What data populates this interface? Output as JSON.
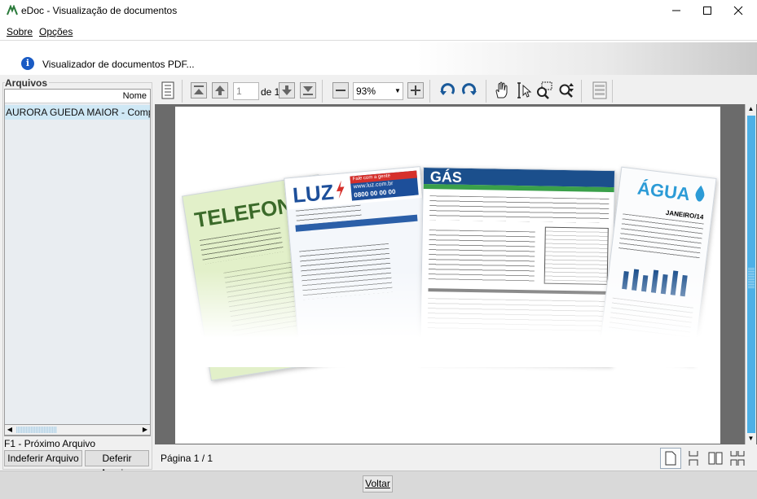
{
  "window": {
    "title": "eDoc - Visualização de documentos",
    "controls": {
      "minimize": "—",
      "maximize": "☐",
      "close": "✕"
    }
  },
  "menu": {
    "items": [
      {
        "label": "Sobre",
        "key": "S"
      },
      {
        "label": "Opções",
        "key": "O"
      }
    ]
  },
  "info": {
    "icon": "info-icon",
    "text": "Visualizador de documentos PDF..."
  },
  "files": {
    "group_label": "Arquivos",
    "column_header": "Nome",
    "items": [
      "AURORA GUEDA MAIOR - Comprovant"
    ],
    "hint": "F1 - Próximo Arquivo",
    "reject_button": "Indeferir Arquivo",
    "accept_button": "Deferir Arquivo"
  },
  "toolbar": {
    "current_page": "1",
    "total_pages_label": "de 1",
    "zoom": "93%",
    "zoom_arrow": "▼",
    "icons": [
      "document-panel-icon",
      "first-page-icon",
      "previous-page-icon",
      "next-page-icon",
      "last-page-icon",
      "zoom-out-icon",
      "zoom-in-icon",
      "rotate-left-icon",
      "rotate-right-icon",
      "hand-tool-icon",
      "text-select-icon",
      "marquee-zoom-icon",
      "dynamic-zoom-icon",
      "print-preview-icon"
    ]
  },
  "document": {
    "bills": [
      {
        "title": "TELEFONE"
      },
      {
        "title": "LUZ",
        "badge1": "Fale com a gente",
        "badge2": "www.luz.com.br",
        "badge3": "0800 00 00 00"
      },
      {
        "title": "GÁS"
      },
      {
        "title": "ÁGUA",
        "month": "JANEIRO/14"
      }
    ]
  },
  "status": {
    "page_text": "Página 1 / 1",
    "view_icons": [
      "single-page-icon",
      "continuous-icon",
      "two-page-icon",
      "two-page-continuous-icon"
    ]
  },
  "footer": {
    "back_button": "Voltar"
  },
  "colors": {
    "selection": "#cfe8f5",
    "accent": "#4db0e6",
    "info_blue": "#1a5bc4",
    "gas_blue": "#1b4f8c",
    "gas_green": "#3aa04a",
    "luz_blue": "#1d4f9a",
    "luz_red": "#d6302b"
  }
}
